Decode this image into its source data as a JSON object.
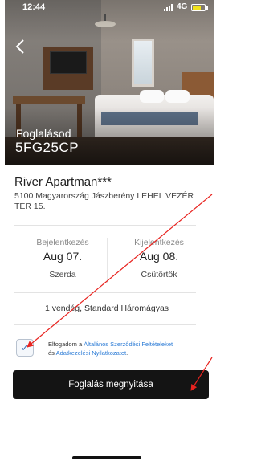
{
  "status_bar": {
    "time": "12:44",
    "network": "4G"
  },
  "hero": {
    "label": "Foglalásod",
    "code": "5FG25CP"
  },
  "hotel": {
    "name": "River Apartman***",
    "address": "5100 Magyarország Jászberény LEHEL VEZÉR TÉR 15."
  },
  "checkin": {
    "label": "Bejelentkezés",
    "date": "Aug 07.",
    "day": "Szerda"
  },
  "checkout": {
    "label": "Kijelentkezés",
    "date": "Aug 08.",
    "day": "Csütörtök"
  },
  "guests": "1 vendég, Standard Háromágyas",
  "terms": {
    "prefix": "Elfogadom a ",
    "link1": "Általános Szerződési Feltételeket",
    "middle": " és ",
    "link2": "Adatkezelési Nyilatkozatot",
    "suffix": ".",
    "checked": true
  },
  "cta": {
    "label": "Foglalás megnyitása"
  },
  "colors": {
    "annotation": "#e8231f",
    "cta_bg": "#141414",
    "link": "#2b7bd6"
  }
}
